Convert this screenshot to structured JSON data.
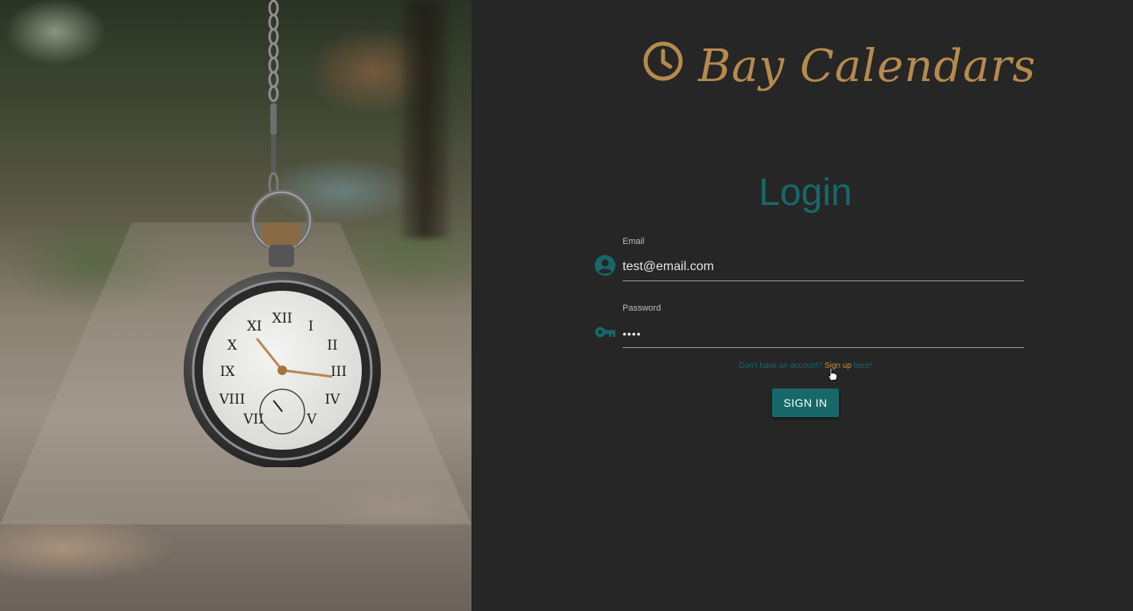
{
  "brand": {
    "name": "Bay Calendars",
    "icon": "clock-icon",
    "color": "#b58a4e"
  },
  "login": {
    "title": "Login",
    "email": {
      "label": "Email",
      "value": "test@email.com",
      "icon": "account-circle-icon"
    },
    "password": {
      "label": "Password",
      "value": "••••",
      "icon": "key-icon"
    },
    "signup": {
      "prefix": "Don't have an account?",
      "link": "Sign up",
      "suffix": "here!"
    },
    "submit_label": "SIGN IN"
  },
  "theme": {
    "accent": "#176869",
    "background": "#262626",
    "link": "#c6923f"
  }
}
